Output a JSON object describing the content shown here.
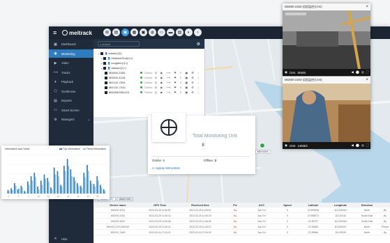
{
  "app": {
    "logo": "meitrack",
    "toolbar": [
      "⊞",
      "▤",
      "◉",
      "▦",
      "▣",
      "◍",
      "▭",
      "▬",
      "▨",
      "◐",
      "›"
    ],
    "toolbar_active": 2
  },
  "sidebar": {
    "items": [
      {
        "label": "Dashboard",
        "icon": "▦"
      },
      {
        "label": "Monitoring",
        "icon": "◉"
      },
      {
        "label": "Video",
        "icon": "▶"
      },
      {
        "label": "Tracks",
        "icon": "⟿"
      },
      {
        "label": "Playback",
        "icon": "⏵"
      },
      {
        "label": "Geofences",
        "icon": "⬡"
      },
      {
        "label": "Reports",
        "icon": "▤"
      },
      {
        "label": "Smart Screen",
        "icon": "▭"
      },
      {
        "label": "Managers",
        "icon": "⚙",
        "chevron": "⌄"
      }
    ],
    "active_index": 1,
    "hide_label": "Hide"
  },
  "tree": {
    "search_placeholder": "search",
    "rows": [
      {
        "indent": 0,
        "label": "admin",
        "count_on": "8",
        "count_total": "5"
      },
      {
        "indent": 1,
        "label": "MeitrackTest",
        "count_on": "4",
        "count_total": "4"
      },
      {
        "indent": 1,
        "label": "songdee",
        "count_on": "0",
        "count_total": "0"
      },
      {
        "indent": 1,
        "label": "daokou",
        "count_on": "0",
        "count_total": "1"
      }
    ],
    "devices": [
      {
        "name": "MD600-2283-",
        "status": "Online"
      },
      {
        "name": "MD500-4149-",
        "status": "Online"
      },
      {
        "name": "MD13X-7006",
        "status": "Online"
      },
      {
        "name": "MD13X-7016",
        "status": "Online"
      },
      {
        "name": "8664080050120",
        "status": "Online"
      }
    ]
  },
  "monitor": {
    "title": "Total Monitoring Unit",
    "total": "8",
    "online_label": "Online:",
    "online_value": "5",
    "offline_label": "Offline:",
    "offline_value": "3",
    "update": "Update Within3Min"
  },
  "map": {
    "tag": "MDX0004"
  },
  "table": {
    "tabs": [
      "Device Info",
      "Alarm Info"
    ],
    "columns": [
      "Device name",
      "GPS Time",
      "Received time",
      "Fix",
      "ACC",
      "Speed",
      "Latitude",
      "Longitude",
      "Direction",
      ""
    ],
    "rows": [
      [
        "MDX00-3024",
        "2023-03-25 11:06:51",
        "2023-03-25 11:06:51",
        "No",
        "Acc On",
        "0",
        "22.593928",
        "114.000264",
        "North",
        "By"
      ],
      [
        "MDX00-2002",
        "2023-03-25 11:06:14",
        "2023-03-25 11:06:15",
        "No",
        "Acc On",
        "0",
        "22.595972",
        "114.00016",
        "South East",
        "By"
      ],
      [
        "MDX00-3002",
        "2023-03-25 11:06:08",
        "2023-03-25 11:06:09",
        "No",
        "Acc On",
        "0",
        "22.59797",
        "114.002263",
        "South East",
        "By"
      ],
      [
        "MDX00-2224-MDX00",
        "2023-03-25 11:06:11",
        "2023-03-25 11:06:12",
        "No",
        "Acc On",
        "0",
        "22.53989",
        "113.940447",
        "North",
        "Phone"
      ],
      [
        "MD13X_3049",
        "2023-03-04 17:04:02",
        "2023-03-04 17:04:02",
        "No",
        "Acc On",
        "0",
        "22.59966",
        "114.00028",
        "North",
        "By"
      ]
    ]
  },
  "chart": {
    "title": "Information and Trend",
    "legend": [
      {
        "name": "Trip Information",
        "color": "#2e7bbd"
      },
      {
        "name": "Trend Information",
        "color": "#8fc3ea"
      }
    ]
  },
  "chart_data": {
    "type": "bar",
    "categories": [
      "1",
      "2",
      "3",
      "4",
      "5",
      "6",
      "7",
      "8",
      "9",
      "10",
      "11",
      "12",
      "13",
      "14",
      "15",
      "16",
      "17",
      "18",
      "19",
      "20",
      "21",
      "22",
      "23",
      "24",
      "25",
      "26",
      "27",
      "28",
      "29",
      "30"
    ],
    "series": [
      {
        "name": "Trip Information",
        "values": [
          4,
          6,
          12,
          5,
          9,
          3,
          14,
          20,
          24,
          8,
          15,
          22,
          18,
          7,
          30,
          26,
          10,
          32,
          40,
          28,
          19,
          12,
          9,
          24,
          33,
          15,
          11,
          20,
          10,
          5
        ]
      },
      {
        "name": "Trend Information",
        "values": [
          3,
          4,
          9,
          6,
          7,
          2,
          10,
          15,
          19,
          5,
          10,
          17,
          14,
          5,
          22,
          20,
          8,
          26,
          32,
          20,
          15,
          9,
          7,
          19,
          26,
          11,
          8,
          15,
          7,
          3
        ]
      }
    ],
    "ylim": [
      0,
      45
    ]
  },
  "videos": [
    {
      "title": "MD600-2283-远程监控(CH1)",
      "channel": "CH1",
      "rate": "0KB/s",
      "controls": [
        "◀",
        "⬤",
        "◎",
        "⛶"
      ]
    },
    {
      "title": "MD600-2283-远程监控(CH4)",
      "channel": "CH4",
      "rate": "14KB/s",
      "controls": [
        "◀",
        "⬤",
        "◎",
        "⛶"
      ]
    }
  ],
  "colors": {
    "accent": "#2e7bbd",
    "sidebar_bg": "#1f2a3a",
    "topbar_bg": "#1c2533",
    "online": "#2aa745"
  }
}
